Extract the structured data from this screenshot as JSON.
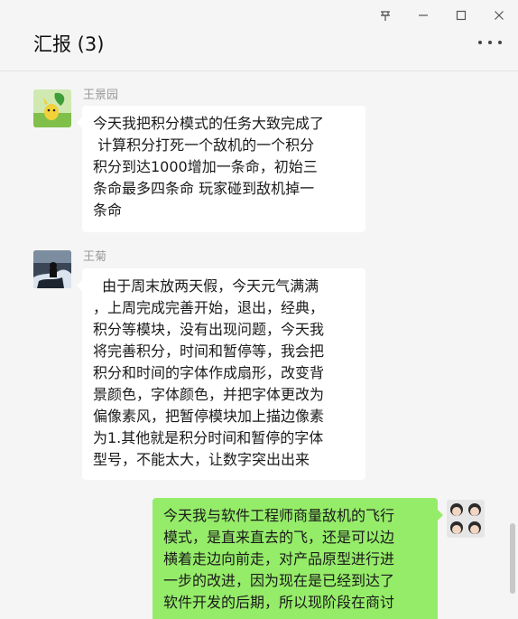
{
  "window": {
    "pin_icon": "pin-icon",
    "minimize_icon": "minimize-icon",
    "maximize_icon": "maximize-icon",
    "close_icon": "close-icon"
  },
  "header": {
    "title": "汇报 (3)",
    "more_icon": "more-icon"
  },
  "messages": [
    {
      "sender": "王景园",
      "text": "今天我把积分模式的任务大致完成了\n 计算积分打死一个敌机的一个积分\n积分到达1000增加一条命，初始三\n条命最多四条命 玩家碰到敌机掉一\n条命"
    },
    {
      "sender": "王菊",
      "text": "  由于周末放两天假，今天元气满满\n，上周完成完善开始，退出，经典，\n积分等模块，没有出现问题，今天我\n将完善积分，时间和暂停等，我会把\n积分和时间的字体作成扇形，改变背\n景颜色，字体颜色，并把字体更改为\n偏像素风，把暂停模块加上描边像素\n为1.其他就是积分时间和暂停的字体\n型号，不能太大，让数字突出出来"
    },
    {
      "sender": "",
      "text": "今天我与软件工程师商量敌机的飞行\n模式，是直来直去的飞，还是可以边\n横着走边向前走，对产品原型进行进\n一步的改进，因为现在是已经到达了\n软件开发的后期，所以现阶段在商讨"
    }
  ],
  "colors": {
    "background": "#f5f5f5",
    "self_bubble": "#95ec69",
    "other_bubble": "#ffffff"
  }
}
